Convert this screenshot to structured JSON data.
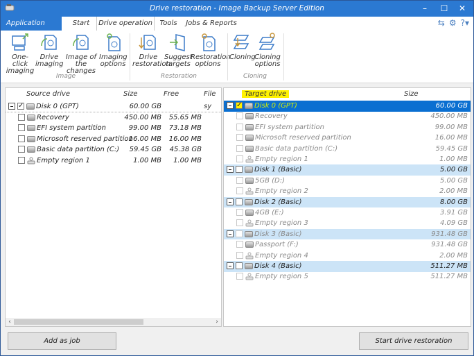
{
  "window": {
    "title": "Drive restoration - Image Backup Server Edition",
    "controls": [
      "minimize",
      "maximize",
      "close"
    ]
  },
  "menu": {
    "app_menu": "Application menu",
    "tabs": [
      {
        "label": "Start",
        "active": false
      },
      {
        "label": "Drive operation",
        "active": true
      },
      {
        "label": "Tools",
        "active": false
      },
      {
        "label": "Jobs & Reports",
        "active": false
      }
    ],
    "quick_icons": [
      "sync-icon",
      "settings-icon",
      "help-icon"
    ]
  },
  "ribbon": {
    "groups": [
      {
        "label": "Image",
        "buttons": [
          {
            "line1": "One-click",
            "line2": "imaging",
            "icon": "one-click-imaging-icon"
          },
          {
            "line1": "Drive",
            "line2": "imaging",
            "icon": "drive-imaging-icon"
          },
          {
            "line1": "Image of the",
            "line2": "changes",
            "icon": "image-changes-icon"
          },
          {
            "line1": "Imaging",
            "line2": "options",
            "icon": "imaging-options-icon"
          }
        ]
      },
      {
        "label": "Restoration",
        "buttons": [
          {
            "line1": "Drive",
            "line2": "restoration",
            "icon": "drive-restoration-icon"
          },
          {
            "line1": "Suggest",
            "line2": "targets",
            "icon": "suggest-targets-icon"
          },
          {
            "line1": "Restoration",
            "line2": "options",
            "icon": "restoration-options-icon"
          }
        ]
      },
      {
        "label": "Cloning",
        "buttons": [
          {
            "line1": "Cloning",
            "line2": "",
            "icon": "cloning-icon"
          },
          {
            "line1": "Cloning",
            "line2": "options",
            "icon": "cloning-options-icon"
          }
        ]
      }
    ]
  },
  "source": {
    "headers": {
      "name": "Source drive",
      "size": "Size",
      "free": "Free",
      "fs": "File sy"
    },
    "rows": [
      {
        "name": "Disk 0 (GPT)",
        "size": "60.00 GB",
        "free": "",
        "type": "disk",
        "checked": true
      },
      {
        "name": "Recovery",
        "size": "450.00 MB",
        "free": "55.65 MB",
        "type": "partition",
        "checked": false
      },
      {
        "name": "EFI system partition",
        "size": "99.00 MB",
        "free": "73.18 MB",
        "type": "partition",
        "checked": false
      },
      {
        "name": "Microsoft reserved partition",
        "size": "16.00 MB",
        "free": "16.00 MB",
        "type": "partition",
        "checked": false
      },
      {
        "name": "Basic data partition (C:)",
        "size": "59.45 GB",
        "free": "45.38 GB",
        "type": "partition",
        "checked": false
      },
      {
        "name": "Empty region 1",
        "size": "1.00 MB",
        "free": "1.00 MB",
        "type": "empty",
        "checked": false
      }
    ]
  },
  "target": {
    "headers": {
      "name": "Target drive",
      "size": "Size"
    },
    "rows": [
      {
        "name": "Disk 0 (GPT)",
        "size": "60.00 GB",
        "type": "disk",
        "checked": true,
        "selected": true
      },
      {
        "name": "Recovery",
        "size": "450.00 MB",
        "type": "partition"
      },
      {
        "name": "EFI system partition",
        "size": "99.00 MB",
        "type": "partition"
      },
      {
        "name": "Microsoft reserved partition",
        "size": "16.00 MB",
        "type": "partition"
      },
      {
        "name": "Basic data partition (C:)",
        "size": "59.45 GB",
        "type": "partition"
      },
      {
        "name": "Empty region 1",
        "size": "1.00 MB",
        "type": "empty"
      },
      {
        "name": "Disk 1 (Basic)",
        "size": "5.00 GB",
        "type": "disk"
      },
      {
        "name": "5GB (D:)",
        "size": "5.00 GB",
        "type": "partition"
      },
      {
        "name": "Empty region 2",
        "size": "2.00 MB",
        "type": "empty"
      },
      {
        "name": "Disk 2 (Basic)",
        "size": "8.00 GB",
        "type": "disk"
      },
      {
        "name": "4GB (E:)",
        "size": "3.91 GB",
        "type": "partition"
      },
      {
        "name": "Empty region 3",
        "size": "4.09 GB",
        "type": "empty"
      },
      {
        "name": "Disk 3 (Basic)",
        "size": "931.48 GB",
        "type": "disk-dim"
      },
      {
        "name": "Passport (F:)",
        "size": "931.48 GB",
        "type": "partition"
      },
      {
        "name": "Empty region 4",
        "size": "2.00 MB",
        "type": "empty"
      },
      {
        "name": "Disk 4 (Basic)",
        "size": "511.27 MB",
        "type": "disk"
      },
      {
        "name": "Empty region 5",
        "size": "511.27 MB",
        "type": "empty"
      }
    ]
  },
  "buttons": {
    "add_job": "Add as job",
    "start": "Start drive restoration"
  },
  "colors": {
    "titlebar": "#2b79d2",
    "selection": "#0a6fd1",
    "disk_highlight": "#cce4f7",
    "annotation_yellow": "#fff200"
  }
}
